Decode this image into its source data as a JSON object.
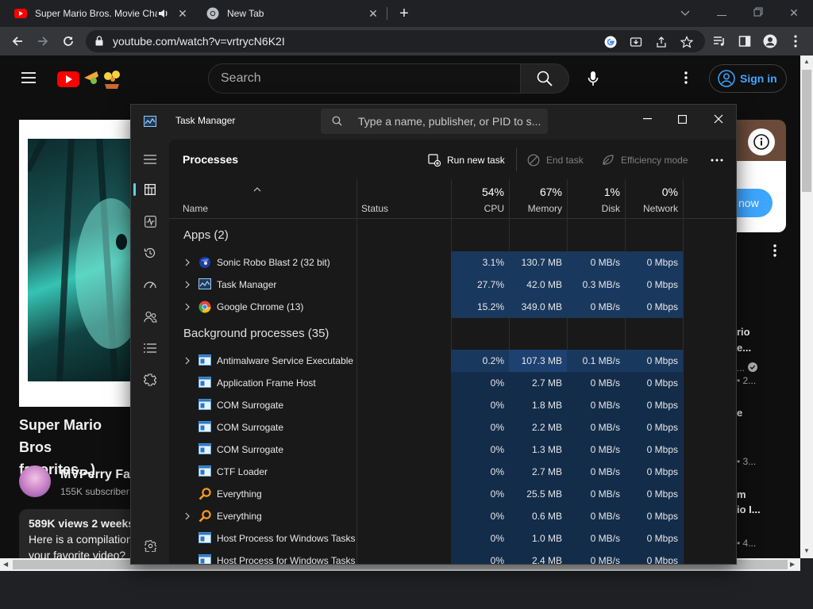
{
  "browser": {
    "tabs": [
      {
        "title": "Super Mario Bros. Movie Cha",
        "favicon": "youtube-icon"
      },
      {
        "title": "New Tab",
        "favicon": "chrome-icon"
      }
    ],
    "url": "youtube.com/watch?v=vrtrycN6K2I",
    "colors": {
      "tabstrip": "#202124",
      "toolbar": "#35363a"
    }
  },
  "youtube": {
    "search_placeholder": "Search",
    "signin_label": "Sign in",
    "video_title_line1": "Super Mario Bros",
    "video_title_line2": "favorites...)",
    "channel_name": "MVPerry Far",
    "subscribers": "155K subscriber",
    "views": "589K views  2 weeks",
    "description_line1": "Here is a compilation",
    "description_line2": "your favorite video?",
    "now_label": "now",
    "side_items": [
      {
        "line1": "rio",
        "line2": "e..."
      },
      {
        "line1": "...",
        "line2": "• 2..."
      },
      {
        "line1": "e",
        "line2": ""
      },
      {
        "line1": "",
        "line2": "• 3..."
      },
      {
        "line1": "m",
        "line2": "io I..."
      },
      {
        "line1": "",
        "line2": "• 4..."
      }
    ]
  },
  "taskmanager": {
    "title": "Task Manager",
    "search_placeholder": "Type a name, publisher, or PID to s...",
    "heading": "Processes",
    "actions": {
      "run": "Run new task",
      "end": "End task",
      "efficiency": "Efficiency mode"
    },
    "columns": {
      "name": "Name",
      "status": "Status",
      "cpu": {
        "pct": "54%",
        "label": "CPU"
      },
      "memory": {
        "pct": "67%",
        "label": "Memory"
      },
      "disk": {
        "pct": "1%",
        "label": "Disk"
      },
      "network": {
        "pct": "0%",
        "label": "Network"
      }
    },
    "groups": {
      "apps": "Apps (2)",
      "background": "Background processes (35)"
    },
    "apps": [
      {
        "name": "Sonic Robo Blast 2 (32 bit)",
        "icon": "srb2-icon",
        "expandable": true,
        "cpu": "3.1%",
        "memory": "130.7 MB",
        "disk": "0 MB/s",
        "network": "0 Mbps"
      },
      {
        "name": "Task Manager",
        "icon": "taskmanager-icon",
        "expandable": true,
        "cpu": "27.7%",
        "memory": "42.0 MB",
        "disk": "0.3 MB/s",
        "network": "0 Mbps"
      },
      {
        "name": "Google Chrome (13)",
        "icon": "chrome-icon",
        "expandable": true,
        "cpu": "15.2%",
        "memory": "349.0 MB",
        "disk": "0 MB/s",
        "network": "0 Mbps"
      }
    ],
    "background": [
      {
        "name": "Antimalware Service Executable",
        "icon": "window-icon",
        "expandable": true,
        "cpu": "0.2%",
        "memory": "107.3 MB",
        "disk": "0.1 MB/s",
        "network": "0 Mbps"
      },
      {
        "name": "Application Frame Host",
        "icon": "window-icon",
        "expandable": false,
        "cpu": "0%",
        "memory": "2.7 MB",
        "disk": "0 MB/s",
        "network": "0 Mbps"
      },
      {
        "name": "COM Surrogate",
        "icon": "window-icon",
        "expandable": false,
        "cpu": "0%",
        "memory": "1.8 MB",
        "disk": "0 MB/s",
        "network": "0 Mbps"
      },
      {
        "name": "COM Surrogate",
        "icon": "window-icon",
        "expandable": false,
        "cpu": "0%",
        "memory": "2.2 MB",
        "disk": "0 MB/s",
        "network": "0 Mbps"
      },
      {
        "name": "COM Surrogate",
        "icon": "window-icon",
        "expandable": false,
        "cpu": "0%",
        "memory": "1.3 MB",
        "disk": "0 MB/s",
        "network": "0 Mbps"
      },
      {
        "name": "CTF Loader",
        "icon": "window-icon",
        "expandable": false,
        "cpu": "0%",
        "memory": "2.7 MB",
        "disk": "0 MB/s",
        "network": "0 Mbps"
      },
      {
        "name": "Everything",
        "icon": "everything-icon",
        "expandable": false,
        "cpu": "0%",
        "memory": "25.5 MB",
        "disk": "0 MB/s",
        "network": "0 Mbps"
      },
      {
        "name": "Everything",
        "icon": "everything-icon",
        "expandable": true,
        "cpu": "0%",
        "memory": "0.6 MB",
        "disk": "0 MB/s",
        "network": "0 Mbps"
      },
      {
        "name": "Host Process for Windows Tasks",
        "icon": "window-icon",
        "expandable": false,
        "cpu": "0%",
        "memory": "1.0 MB",
        "disk": "0 MB/s",
        "network": "0 Mbps"
      },
      {
        "name": "Host Process for Windows Tasks",
        "icon": "window-icon",
        "expandable": false,
        "cpu": "0%",
        "memory": "2.4 MB",
        "disk": "0 MB/s",
        "network": "0 Mbps"
      }
    ],
    "colors": {
      "accent": "#60cdff",
      "heat_low": "#132c4a",
      "heat_mid": "#19385e",
      "window_bg": "#202020",
      "content_bg": "#191919"
    }
  }
}
